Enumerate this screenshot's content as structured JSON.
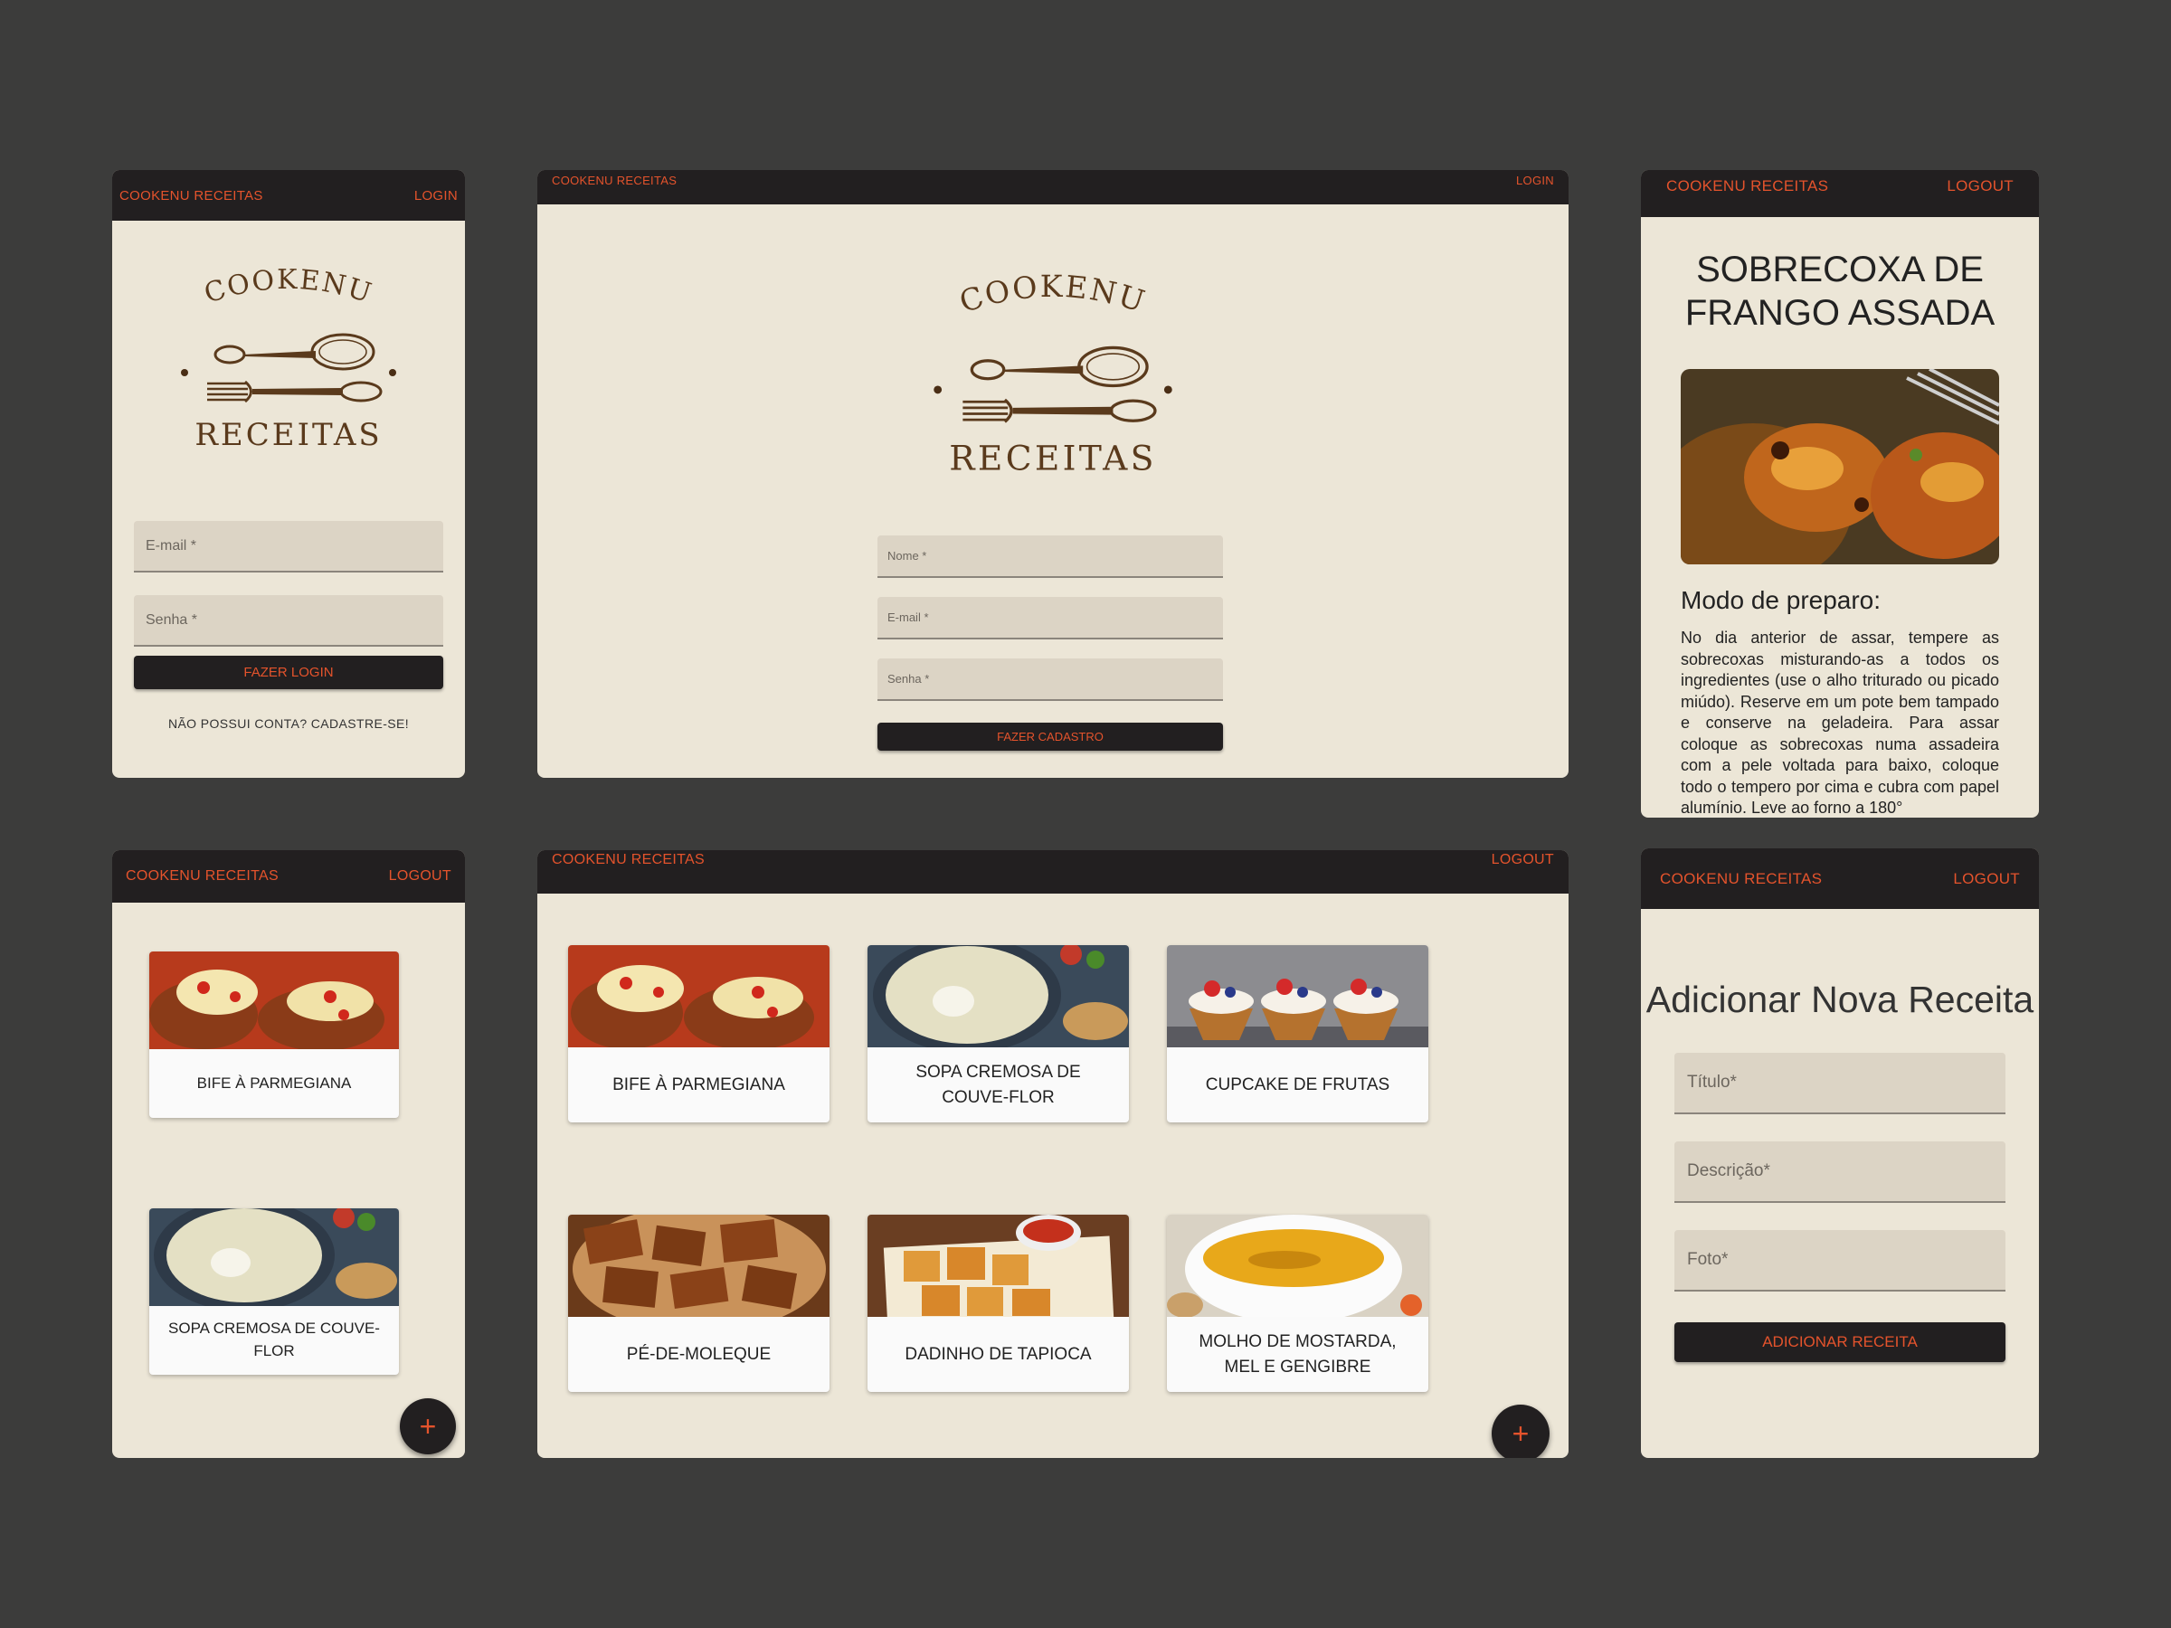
{
  "colors": {
    "accent": "#e4532c",
    "bar": "#221f20",
    "panel": "#ece6d7",
    "field": "#dcd4c5",
    "logo": "#5a3a1c"
  },
  "logo": {
    "top": "COOKENU",
    "bottom": "RECEITAS"
  },
  "login_mobile": {
    "brand": "COOKENU RECEITAS",
    "nav": "LOGIN",
    "email": "E-mail *",
    "password": "Senha *",
    "submit": "FAZER LOGIN",
    "signup_link": "NÃO POSSUI CONTA? CADASTRE-SE!"
  },
  "signup_desktop": {
    "brand": "COOKENU RECEITAS",
    "nav": "LOGIN",
    "name": "Nome *",
    "email": "E-mail *",
    "password": "Senha *",
    "submit": "FAZER CADASTRO"
  },
  "recipe_detail": {
    "brand": "COOKENU RECEITAS",
    "nav": "LOGOUT",
    "title": "SOBRECOXA DE FRANGO ASSADA",
    "section": "Modo de preparo:",
    "text": "No dia anterior de assar, tempere as sobrecoxas misturando-as a todos os ingredientes (use o alho triturado ou picado miúdo). Reserve em um pote bem tampado e conserve na geladeira. Para assar coloque as sobrecoxas numa assadeira com a pele voltada para baixo, coloque todo o tempero por cima e cubra com papel alumínio. Leve ao forno a 180°"
  },
  "feed_mobile": {
    "brand": "COOKENU RECEITAS",
    "nav": "LOGOUT",
    "cards": [
      "BIFE À PARMEGIANA",
      "SOPA CREMOSA DE COUVE-FLOR"
    ],
    "fab": "+"
  },
  "feed_desktop": {
    "brand": "COOKENU RECEITAS",
    "nav": "LOGOUT",
    "cards": [
      "BIFE À PARMEGIANA",
      "SOPA CREMOSA DE COUVE-FLOR",
      "CUPCAKE DE FRUTAS",
      "PÉ-DE-MOLEQUE",
      "DADINHO DE TAPIOCA",
      "MOLHO DE MOSTARDA, MEL E GENGIBRE"
    ],
    "fab": "+"
  },
  "add_recipe": {
    "brand": "COOKENU RECEITAS",
    "nav": "LOGOUT",
    "title": "Adicionar Nova Receita",
    "field_title": "Título*",
    "field_description": "Descrição*",
    "field_photo": "Foto*",
    "submit": "ADICIONAR RECEITA"
  }
}
